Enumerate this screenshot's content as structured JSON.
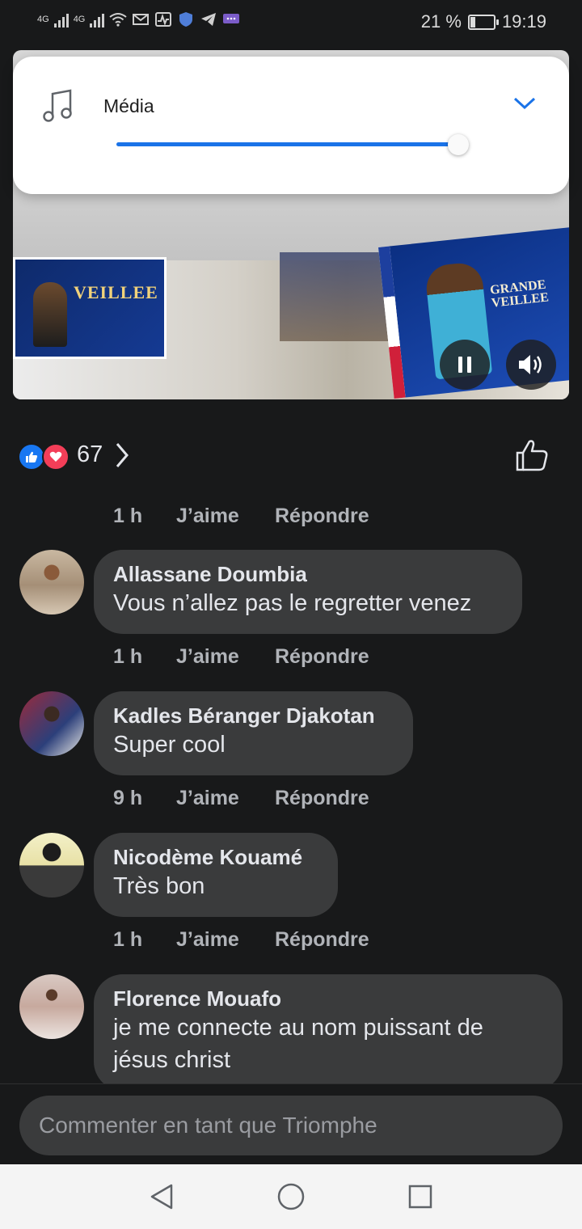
{
  "status_bar": {
    "network_1": "4G",
    "network_2": "4G",
    "battery_text": "21 %",
    "battery_level_percent": 21,
    "time": "19:19",
    "icons": [
      "signal-icon",
      "signal-icon",
      "wifi-icon",
      "mail-icon",
      "activity-icon",
      "shield-icon",
      "telegram-icon",
      "chat-icon"
    ]
  },
  "volume_panel": {
    "label": "Média",
    "level_percent": 100,
    "accent": "#1a73e8"
  },
  "video": {
    "poster_left_title": "VEILLEE",
    "poster_right_title": "GRANDE VEILLEE",
    "controls": [
      "pause-icon",
      "volume-icon"
    ]
  },
  "reactions": {
    "count": "67",
    "like_color": "#1877f2",
    "love_color": "#f33e58"
  },
  "actions": {
    "like_label": "J’aime",
    "reply_label": "Répondre"
  },
  "comments": {
    "first_meta_time": "1 h",
    "items": [
      {
        "name": "Allassane Doumbia",
        "text": "Vous n’allez pas le regretter venez",
        "time": "1 h"
      },
      {
        "name": "Kadles Béranger Djakotan",
        "text": "Super cool",
        "time": "9 h"
      },
      {
        "name": "Nicodème Kouamé",
        "text": "Très bon",
        "time": "1 h"
      },
      {
        "name": "Florence Mouafo",
        "text": "je me connecte au nom puissant de jésus christ",
        "time": ""
      }
    ]
  },
  "composer": {
    "placeholder": "Commenter en tant que Triomphe"
  },
  "navbar": {
    "buttons": [
      "back-icon",
      "home-icon",
      "recents-icon"
    ]
  }
}
